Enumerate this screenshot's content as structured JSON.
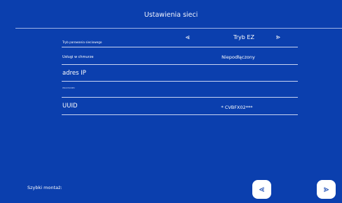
{
  "header": {
    "title": "Ustawienia sieci"
  },
  "settings": {
    "pairing_mode": {
      "label": "Tryb parowania sieciowego",
      "value": "Tryb EZ",
      "prev_glyph": "⪡",
      "next_glyph": "⪢"
    },
    "cloud_services": {
      "label": "Usługi w chmurze",
      "value": "Niepodłączony"
    },
    "ip_address": {
      "label": "adres IP"
    },
    "small_label": {
      "label": "PROCHOWIEC"
    },
    "uuid": {
      "label": "UUID",
      "value": "* CVBFX02***"
    }
  },
  "footer": {
    "quick_setup_label": "Szybki montaż:",
    "prev_glyph": "⪡",
    "next_glyph": "⪢"
  },
  "colors": {
    "background": "#0b3fae",
    "line": "#c9d4f2",
    "text": "#ffffff"
  },
  "icons": {
    "pairing_prev": "double-chevron-left-icon",
    "pairing_next": "double-chevron-right-icon",
    "footer_prev": "double-chevron-left-icon",
    "footer_next": "double-chevron-right-icon"
  }
}
